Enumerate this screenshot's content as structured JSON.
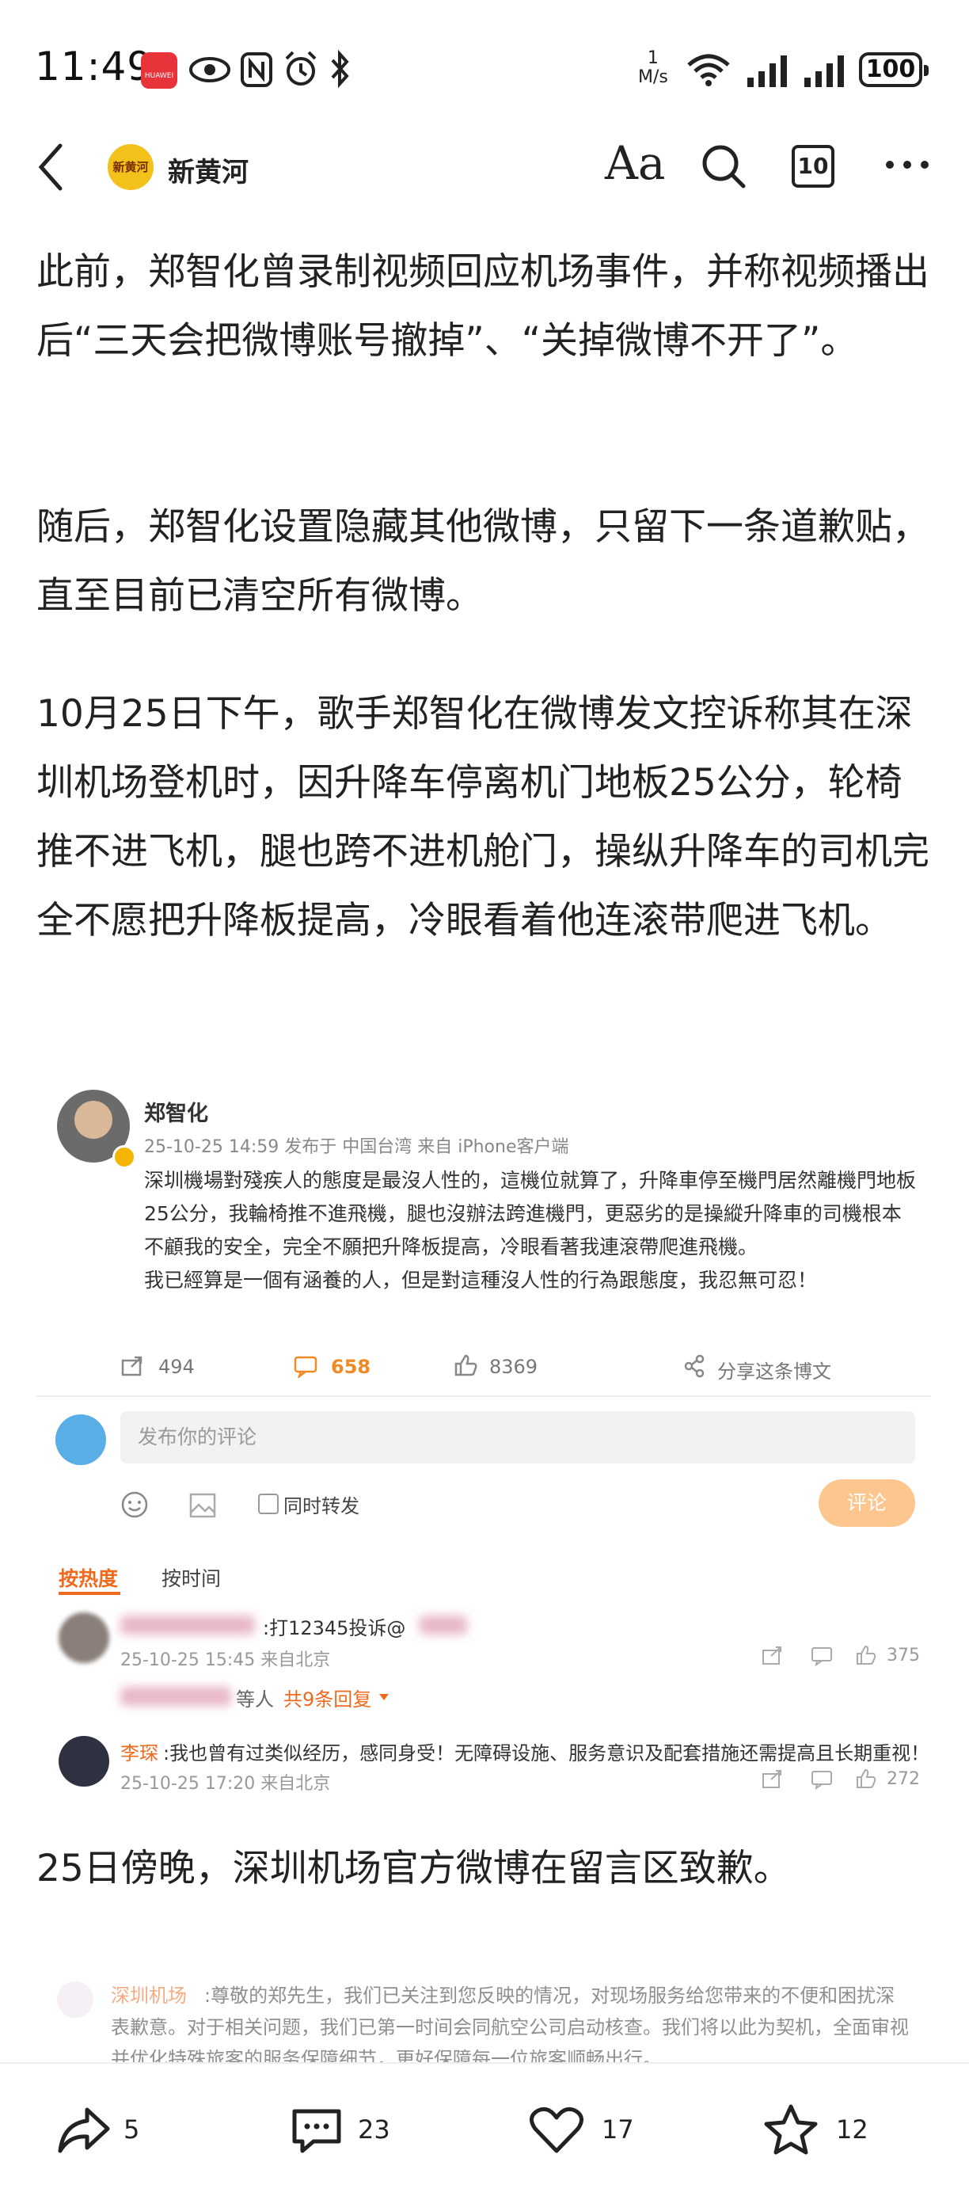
{
  "status_bar": {
    "time": "11:49",
    "network_speed_value": "1",
    "network_speed_unit": "M/s",
    "battery": "100",
    "huawei_label": "HUAWEI"
  },
  "app_bar": {
    "brand": "新黄河",
    "logo_text": "新黄河",
    "font_button": "Aa",
    "comment_count": "10"
  },
  "article": {
    "p1": "此前，郑智化曾录制视频回应机场事件，并称视频播出后“三天会把微博账号撤掉”、“关掉微博不开了”。",
    "p2": "随后，郑智化设置隐藏其他微博，只留下一条道歉贴，直至目前已清空所有微博。",
    "p3": "10月25日下午，歌手郑智化在微博发文控诉称其在深圳机场登机时，因升降车停离机门地板25公分，轮椅推不进飞机，腿也跨不进机舱门，操纵升降车的司机完全不愿把升降板提高，冷眼看着他连滚带爬进飞机。",
    "p4": "25日傍晚，深圳机场官方微博在留言区致歉。"
  },
  "weibo": {
    "name": "郑智化",
    "meta": "25-10-25 14:59  发布于 中国台湾  来自 iPhone客户端",
    "text1": "深圳機場對殘疾人的態度是最沒人性的，這機位就算了，升降車停至機門居然離機門地板25公分，我輪椅推不進飛機，腿也沒辦法跨進機門，更惡劣的是操縱升降車的司機根本不顧我的安全，完全不願把升降板提高，冷眼看著我連滾帶爬進飛機。",
    "text2": "我已經算是一個有涵養的人，但是對這種沒人性的行為跟態度，我忍無可忍！",
    "reposts": "494",
    "comments": "658",
    "likes": "8369",
    "share": "分享这条博文",
    "comment_placeholder": "发布你的评论",
    "repost_option": "同时转发",
    "post_button": "评论",
    "sort_hot": "按热度",
    "sort_time": "按时间",
    "comments_list": [
      {
        "text": ":打12345投诉@",
        "meta": "25-10-25 15:45 来自北京",
        "likes": "375"
      },
      {
        "user": "李琛",
        "text": ":我也曾有过类似经历，感同身受！无障碍设施、服务意识及配套措施还需提高且长期重视！",
        "meta": "25-10-25 17:20 来自北京",
        "likes": "272"
      }
    ],
    "reply_prefix": "等人",
    "reply_link": "共9条回复"
  },
  "airport_reply": {
    "user": "深圳机场",
    "text1": ":尊敬的郑先生，我们已关注到您反映的情况，对现场服务给您带来的不便和困扰深",
    "text2": "表歉意。对于相关问题，我们已第一时间会同航空公司启动核查。我们将以此为契机，全面审视",
    "text3": "并优化特殊旅客的服务保障细节，更好保障每一位旅客顺畅出行。"
  },
  "bottom_bar": {
    "shares": "5",
    "comments": "23",
    "likes": "17",
    "favorites": "12"
  }
}
